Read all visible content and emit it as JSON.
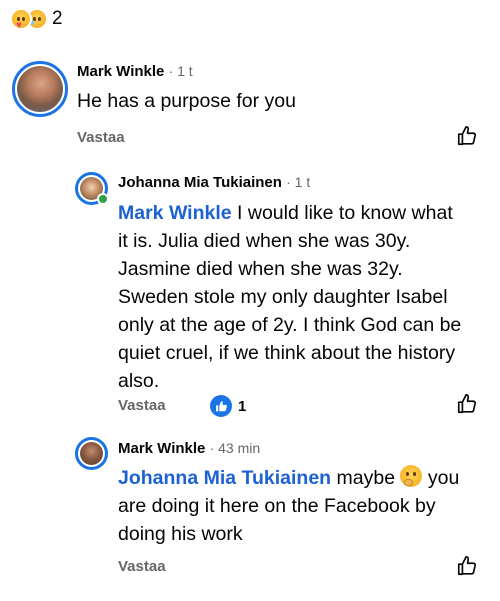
{
  "post_reactions": {
    "count": "2",
    "icons": [
      "care-emoji",
      "sad-emoji"
    ]
  },
  "comment1": {
    "author": "Mark Winkle",
    "time": "· 1 t",
    "text": "He has a purpose for you",
    "reply_label": "Vastaa"
  },
  "reply1": {
    "author": "Johanna Mia Tukiainen",
    "time": "· 1 t",
    "mention": "Mark Winkle",
    "lines": [
      " I would like to know what",
      "it is. Julia died when she was 30y.",
      "Jasmine died when she was 32y.",
      "Sweden stole my only daughter Isabel",
      "only at the age of 2y. I think God can be",
      "quiet cruel, if we think about the history",
      "also."
    ],
    "reply_label": "Vastaa",
    "like_count": "1"
  },
  "reply2": {
    "author": "Mark Winkle",
    "time": "· 43 min",
    "mention": "Johanna Mia Tukiainen",
    "line1_rest_a": " maybe ",
    "line1_rest_b": " you",
    "lines": [
      "are doing it here on the Facebook by",
      "doing his work"
    ],
    "reply_label": "Vastaa"
  }
}
